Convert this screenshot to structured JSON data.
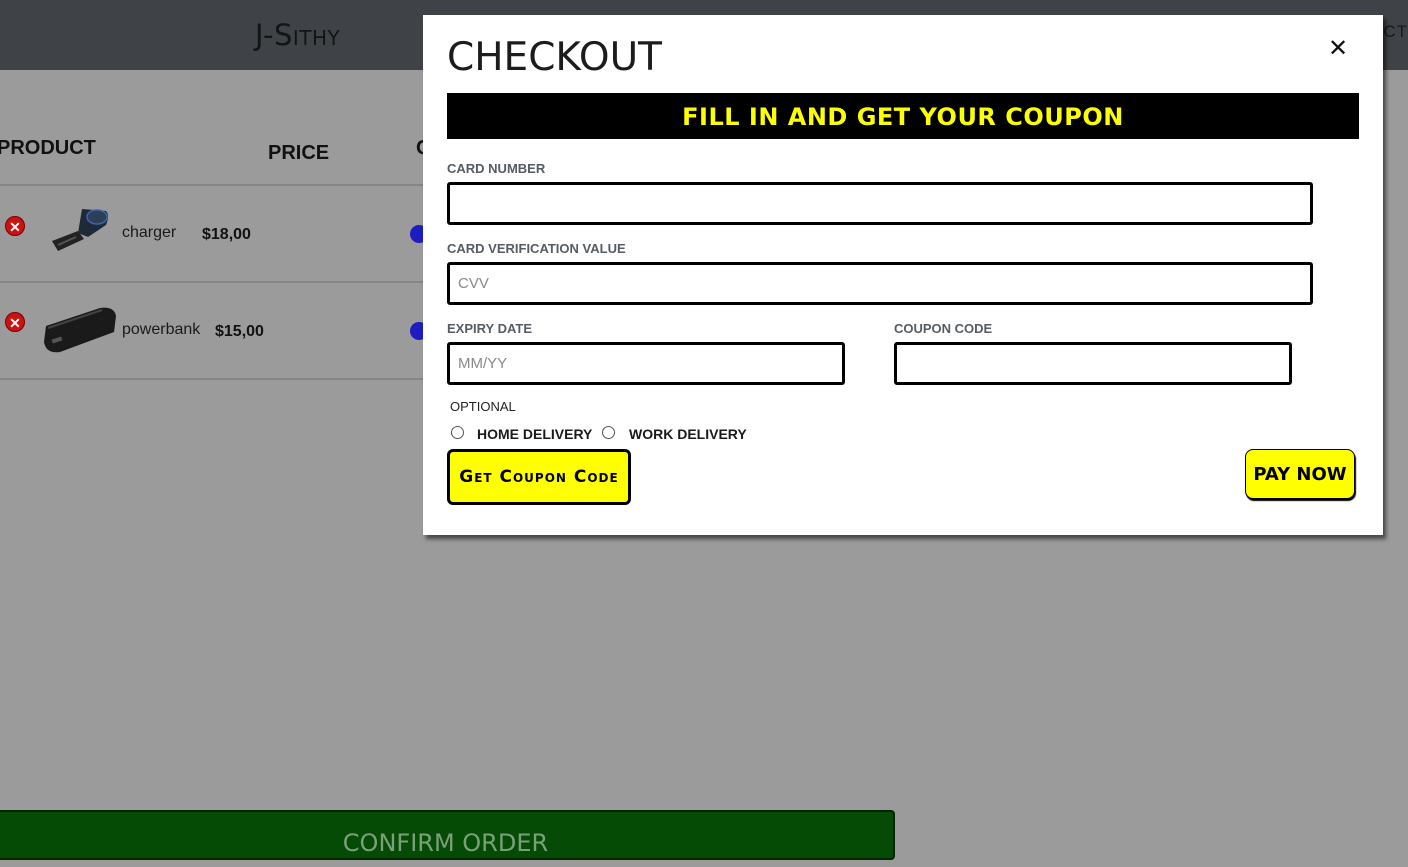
{
  "header": {
    "brand": "J-Sithy",
    "nav_partial": "CT"
  },
  "cart": {
    "columns": {
      "product": "PRODUCT",
      "price": "PRICE",
      "quantity_partial": "Q"
    },
    "items": [
      {
        "name": "charger",
        "price": "$18,00"
      },
      {
        "name": "powerbank",
        "price": "$15,00"
      }
    ],
    "remove_symbol": "✕",
    "confirm_label": "CONFIRM ORDER"
  },
  "modal": {
    "title": "CHECKOUT",
    "close_symbol": "✕",
    "banner": "FILL IN AND GET YOUR COUPON",
    "card_number": {
      "label": "CARD NUMBER",
      "value": "",
      "placeholder": ""
    },
    "cvv": {
      "label": "CARD VERIFICATION VALUE",
      "value": "",
      "placeholder": "CVV"
    },
    "expiry": {
      "label": "EXPIRY DATE",
      "value": "",
      "placeholder": "MM/YY"
    },
    "coupon": {
      "label": "COUPON CODE",
      "value": "",
      "placeholder": ""
    },
    "optional_label": "OPTIONAL",
    "delivery_options": [
      "HOME DELIVERY",
      "WORK DELIVERY"
    ],
    "get_coupon_label": "Get Coupon Code",
    "pay_label": "PAY NOW"
  },
  "colors": {
    "backdrop": "#9b9b9b",
    "topbar": "#3f4347",
    "accent_yellow": "#ffff00",
    "banner_bg": "#000000",
    "confirm_green": "#054a05",
    "remove_red": "#cc1111",
    "qty_blue": "#1d1dc0"
  }
}
